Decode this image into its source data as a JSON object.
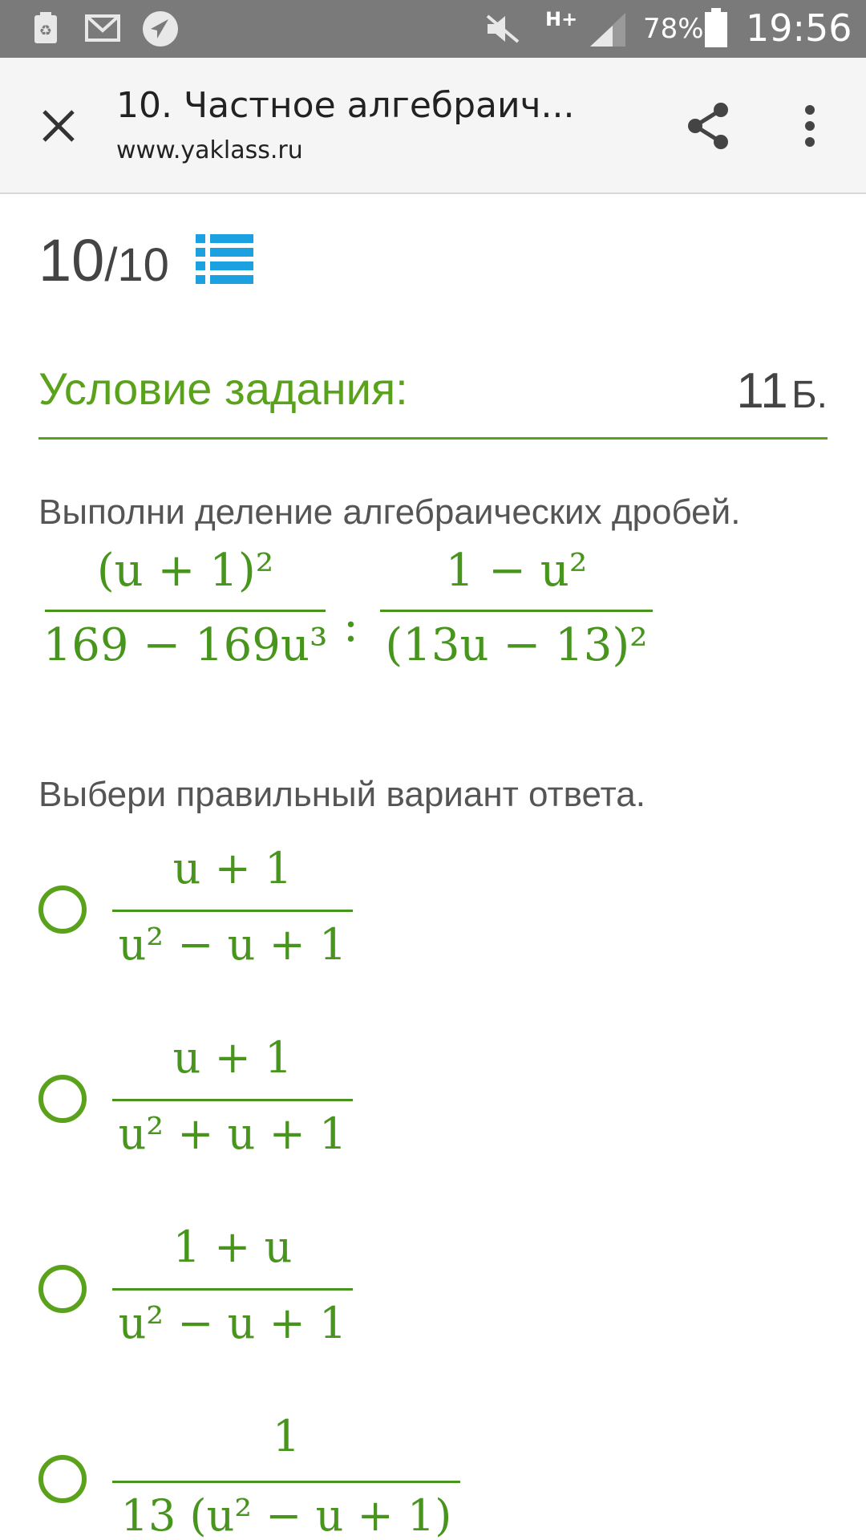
{
  "status_bar": {
    "network": "H+",
    "battery": "78%",
    "time": "19:56",
    "icons": [
      "recycle-icon",
      "mail-icon",
      "navigation-icon",
      "mute-icon",
      "signal-icon",
      "battery-icon"
    ]
  },
  "app_bar": {
    "title": "10. Частное алгебраич...",
    "url": "www.yaklass.ru",
    "icons": [
      "close-icon",
      "share-icon",
      "more-vert-icon"
    ]
  },
  "progress": {
    "current": "10",
    "total": "/10"
  },
  "condition": {
    "title": "Условие задания:",
    "points_value": "11",
    "points_unit": "Б."
  },
  "task": {
    "instruction": "Выполни деление алгебраических дробей.",
    "frac1_num": "(u + 1)²",
    "frac1_den": "169 − 169u³",
    "operator": ":",
    "frac2_num": "1 − u²",
    "frac2_den": "(13u − 13)²"
  },
  "choose_prompt": "Выбери правильный вариант ответа.",
  "options": [
    {
      "num": "u + 1",
      "den": "u² − u + 1"
    },
    {
      "num": "u + 1",
      "den": "u² + u + 1"
    },
    {
      "num": "1 + u",
      "den": "u² − u + 1"
    },
    {
      "num": "1",
      "den": "13 (u² − u + 1)"
    }
  ],
  "colors": {
    "accent_green": "#5aa21c",
    "math_green": "#47951c",
    "list_icon_blue": "#1ba1e2",
    "status_bar": "#7a7a7a"
  }
}
